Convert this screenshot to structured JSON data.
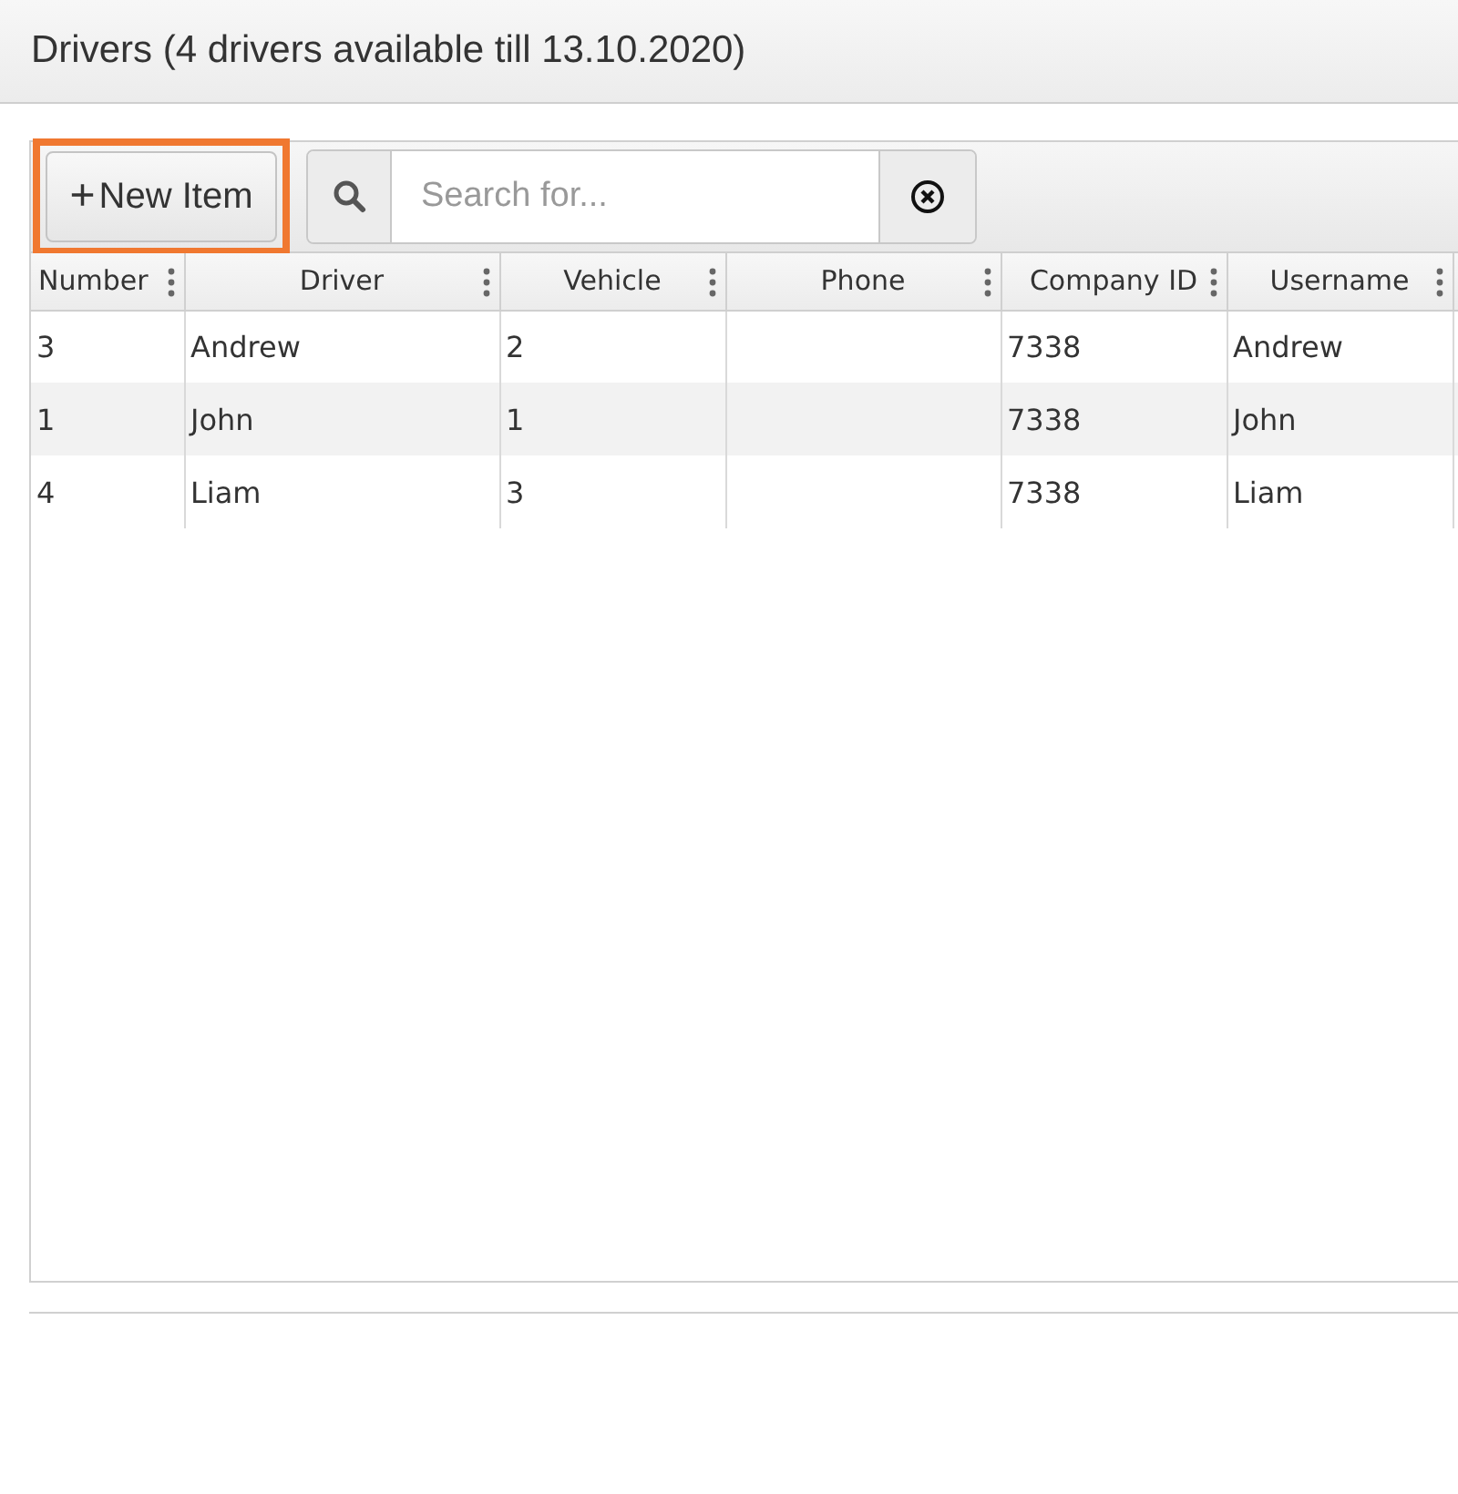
{
  "title": "Drivers (4 drivers available till 13.10.2020)",
  "toolbar": {
    "new_button": {
      "icon": "+",
      "label": "New Item",
      "highlighted": true
    },
    "search": {
      "placeholder": "Search for..."
    }
  },
  "table": {
    "columns": [
      "Number",
      "Driver",
      "Vehicle",
      "Phone",
      "Company ID",
      "Username"
    ],
    "rows": [
      [
        "3",
        "Andrew",
        "2",
        "",
        "7338",
        "Andrew"
      ],
      [
        "1",
        "John",
        "1",
        "",
        "7338",
        "John"
      ],
      [
        "4",
        "Liam",
        "3",
        "",
        "7338",
        "Liam"
      ]
    ]
  }
}
